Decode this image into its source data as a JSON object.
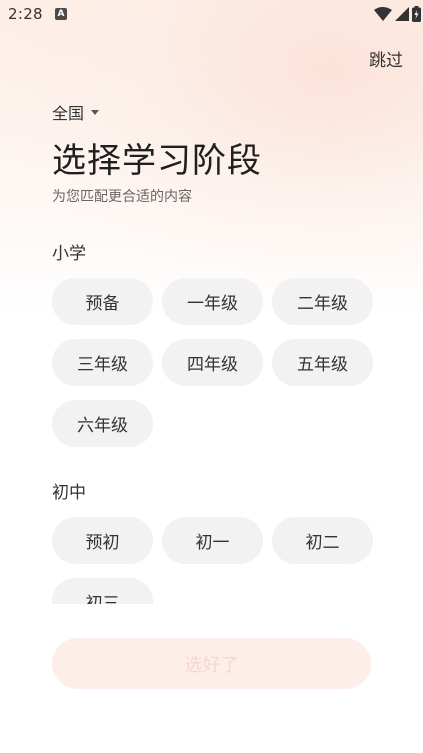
{
  "status_bar": {
    "time": "2:28",
    "notification_badge": "A"
  },
  "header": {
    "skip_label": "跳过",
    "region_label": "全国",
    "title": "选择学习阶段",
    "subtitle": "为您匹配更合适的内容"
  },
  "sections": [
    {
      "title": "小学",
      "grades": [
        "预备",
        "一年级",
        "二年级",
        "三年级",
        "四年级",
        "五年级",
        "六年级"
      ]
    },
    {
      "title": "初中",
      "grades": [
        "预初",
        "初一",
        "初二",
        "初三"
      ]
    }
  ],
  "footer": {
    "confirm_label": "选好了"
  },
  "colors": {
    "chip_background": "#f2f2f2",
    "confirm_disabled_background": "#fdeeea",
    "confirm_disabled_text": "#f8d6cf"
  }
}
